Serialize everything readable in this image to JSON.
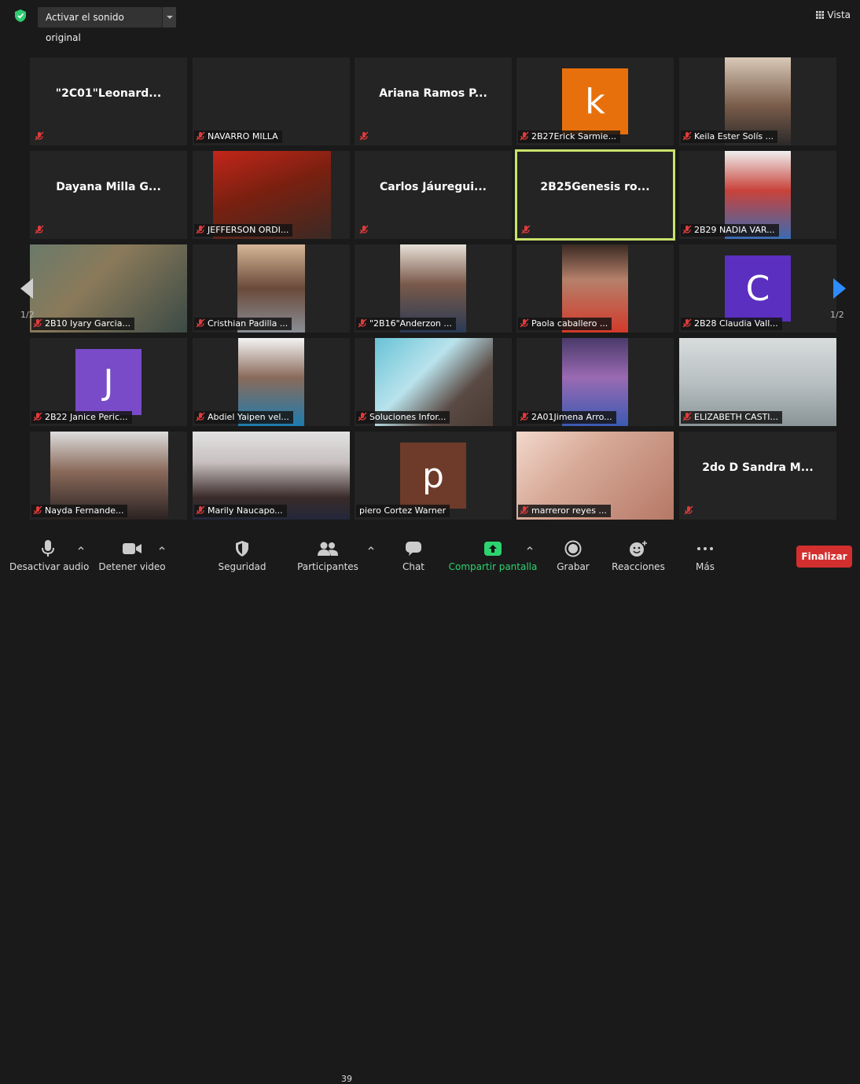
{
  "topbar": {
    "sound_label": "Activar el sonido original",
    "view_label": "Vista"
  },
  "tiles": [
    {
      "name": "\"2C01\"Leonard...",
      "mode": "name"
    },
    {
      "name": "NAVARRO MILLA",
      "mode": "video"
    },
    {
      "name": "Ariana Ramos P...",
      "mode": "name"
    },
    {
      "name": "2B27Erick Sarmie...",
      "mode": "avatar",
      "initial": "k",
      "color": "#e8700c"
    },
    {
      "name": "Keila Ester Solís ...",
      "mode": "video"
    },
    {
      "name": "Dayana  Milla G...",
      "mode": "name"
    },
    {
      "name": "JEFFERSON ORDI...",
      "mode": "video"
    },
    {
      "name": "Carlos  Jáuregui...",
      "mode": "name"
    },
    {
      "name": "2B25Genesis ro...",
      "mode": "name",
      "active": true
    },
    {
      "name": "2B29 NADIA VAR...",
      "mode": "video"
    },
    {
      "name": "2B10 Iyary Garcia...",
      "mode": "video"
    },
    {
      "name": "Cristhian Padilla ...",
      "mode": "video"
    },
    {
      "name": "\"2B16\"Anderzon ...",
      "mode": "video"
    },
    {
      "name": "Paola caballero ...",
      "mode": "video"
    },
    {
      "name": "2B28 Claudia Vall...",
      "mode": "avatar",
      "initial": "C",
      "color": "#5b2fbf"
    },
    {
      "name": "2B22 Janice Peric...",
      "mode": "avatar",
      "initial": "J",
      "color": "#7a4bc9"
    },
    {
      "name": "Abdiel Yaipen vel...",
      "mode": "video"
    },
    {
      "name": "Soluciones Infor...",
      "mode": "video"
    },
    {
      "name": "2A01Jimena Arro...",
      "mode": "video"
    },
    {
      "name": "ELIZABETH CASTI...",
      "mode": "video"
    },
    {
      "name": "Nayda Fernande...",
      "mode": "video"
    },
    {
      "name": "Marily Naucapo...",
      "mode": "video"
    },
    {
      "name": "piero Cortez Warner",
      "mode": "avatar",
      "initial": "p",
      "color": "#6e3b2a",
      "nomic": true
    },
    {
      "name": "marreror reyes ...",
      "mode": "video"
    },
    {
      "name": "2do D Sandra M...",
      "mode": "name"
    }
  ],
  "pagination": {
    "left": "1/2",
    "right": "1/2"
  },
  "toolbar": {
    "mute": "Desactivar audio",
    "video": "Detener video",
    "security": "Seguridad",
    "participants": "Participantes",
    "participants_count": "39",
    "chat": "Chat",
    "share": "Compartir pantalla",
    "record": "Grabar",
    "reactions": "Reacciones",
    "more": "Más",
    "end": "Finalizar"
  },
  "colors": {
    "share": "#2dd36f",
    "end": "#d32f2f",
    "active_border": "#c9e26a",
    "mic_muted": "#e03b3b"
  }
}
